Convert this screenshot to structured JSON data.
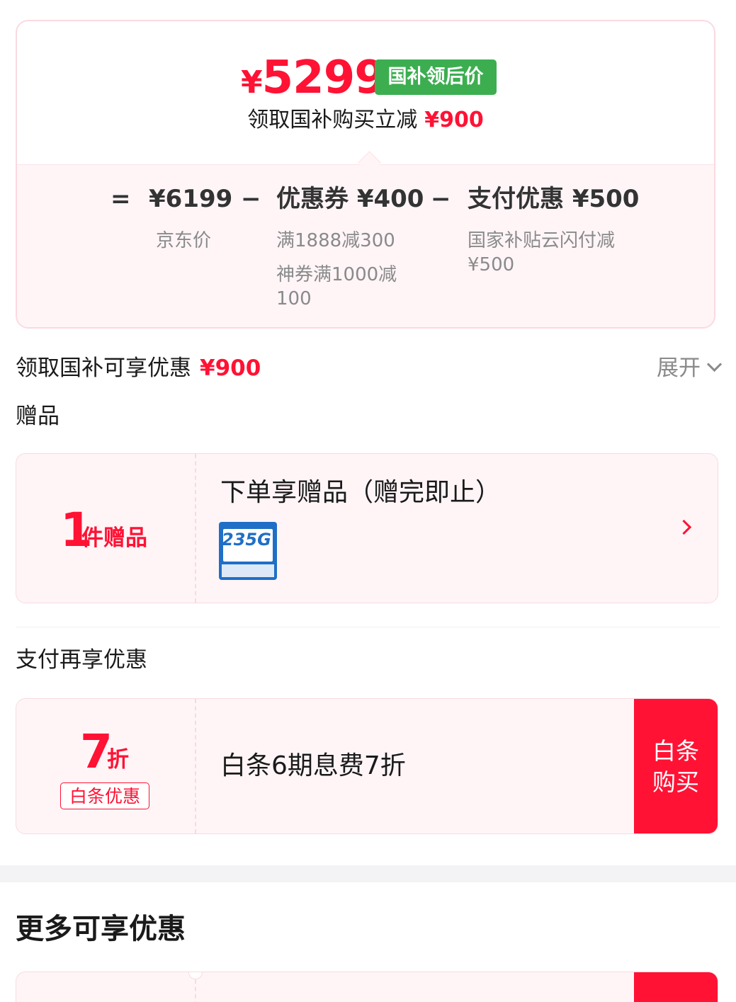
{
  "colors": {
    "accent": "#ff1234",
    "subsidy_badge": "#3cae50",
    "card_bg": "#fff5f7"
  },
  "price": {
    "currency": "¥",
    "final_amount": "5299",
    "badge": "国补领后价",
    "subsidy_text": "领取国补购买立减",
    "subsidy_amount": "¥900"
  },
  "formula": {
    "equals": "=",
    "minus": "−",
    "base": {
      "value": "¥6199",
      "label": "京东价"
    },
    "coupon": {
      "value": "优惠券 ¥400",
      "line1": "满1888减300",
      "line2": "神券满1000减",
      "line3": "100"
    },
    "payment": {
      "value": "支付优惠 ¥500",
      "line1": "国家补贴云闪付减",
      "line2": "¥500"
    }
  },
  "subsidy_row": {
    "label": "领取国补可享优惠",
    "amount": "¥900",
    "expand": "展开",
    "expand_icon": "chevron-down-icon"
  },
  "gifts": {
    "section_title": "赠品",
    "count": "1",
    "unit": "件赠品",
    "title": "下单享赠品（赠完即止）",
    "thumb_text": "235G"
  },
  "payment_offer": {
    "section_title": "支付再享优惠",
    "number": "7",
    "unit": "折",
    "tag": "白条优惠",
    "title": "白条6期息费7折",
    "button_line1": "白条",
    "button_line2": "购买"
  },
  "more": {
    "title": "更多可享优惠"
  }
}
